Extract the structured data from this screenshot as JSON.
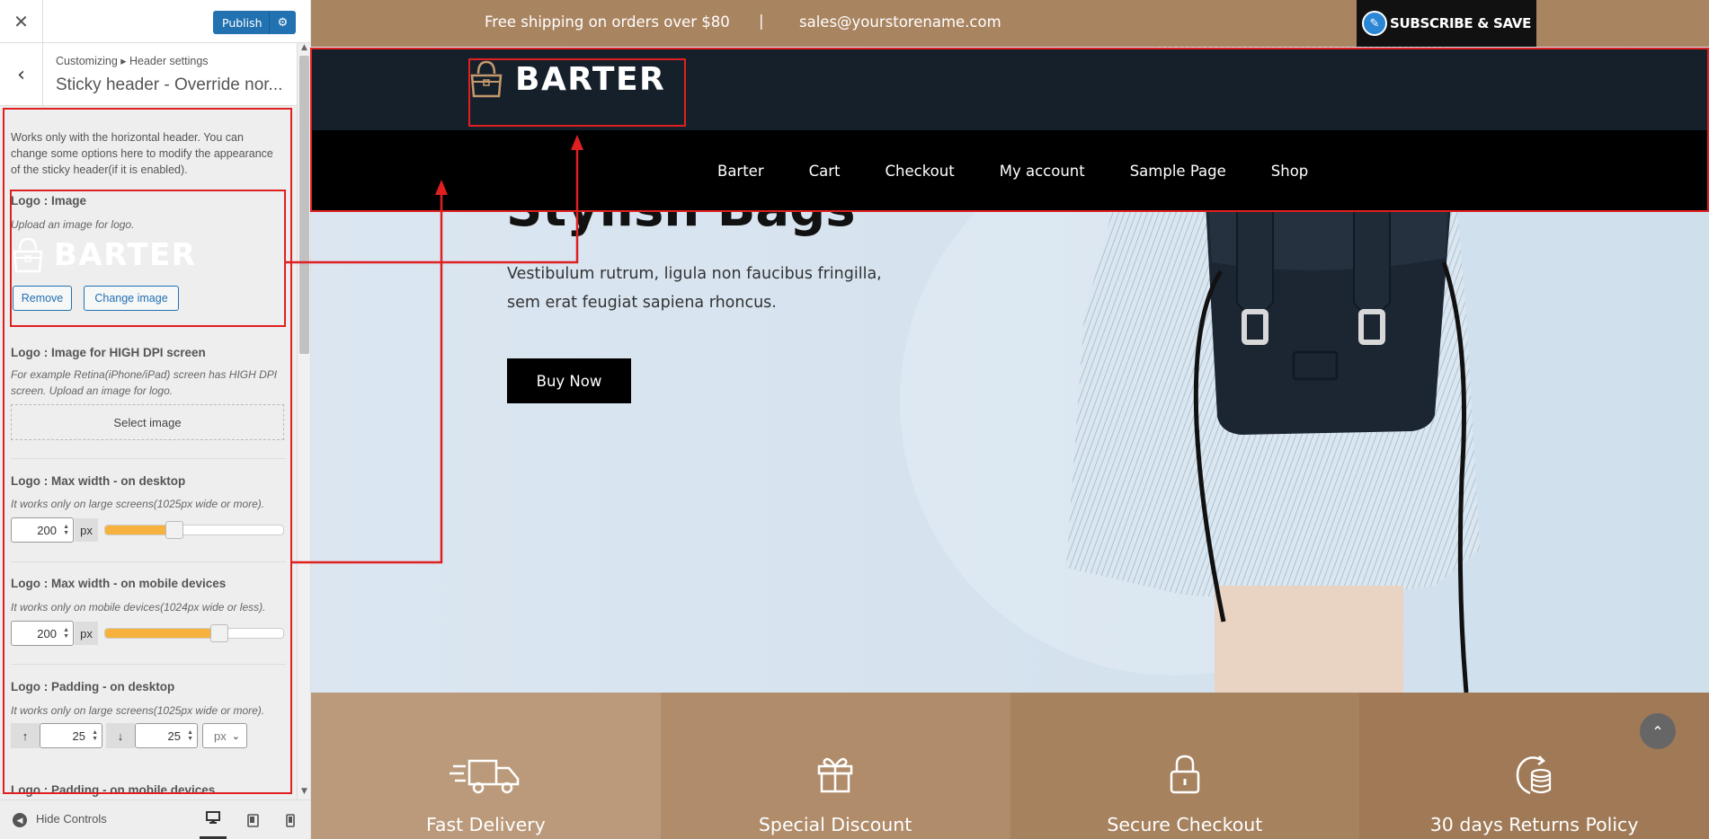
{
  "customizer": {
    "close_icon": "✕",
    "publish_label": "Publish",
    "publish_gear_icon": "⚙",
    "back_icon": "‹",
    "breadcrumb": "Customizing ▸ Header settings",
    "section_title": "Sticky header - Override nor...",
    "description": "Works only with the horizontal header. You can change some options here to modify the appearance of the sticky header(if it is enabled).",
    "logo_image": {
      "title": "Logo : Image",
      "note": "Upload an image for logo.",
      "preview_text": "BARTER",
      "remove_label": "Remove",
      "change_label": "Change image"
    },
    "logo_hidpi": {
      "title": "Logo : Image for HIGH DPI screen",
      "note": "For example Retina(iPhone/iPad) screen has HIGH DPI screen. Upload an image for logo.",
      "select_label": "Select image"
    },
    "max_width_desktop": {
      "title": "Logo : Max width - on desktop",
      "note": "It works only on large screens(1025px wide or more).",
      "value": "200",
      "unit": "px",
      "slider_fraction": 0.39
    },
    "max_width_mobile": {
      "title": "Logo : Max width - on mobile devices",
      "note": "It works only on mobile devices(1024px wide or less).",
      "value": "200",
      "unit": "px",
      "slider_fraction": 0.64
    },
    "padding_desktop": {
      "title": "Logo : Padding - on desktop",
      "note": "It works only on large screens(1025px wide or more).",
      "top_icon": "↑",
      "top_value": "25",
      "bottom_icon": "↓",
      "bottom_value": "25",
      "unit": "px"
    },
    "padding_mobile_title": "Logo : Padding - on mobile devices",
    "footer": {
      "hide_label": "Hide Controls"
    }
  },
  "site": {
    "topbar": {
      "promo": "Free shipping on orders over $80",
      "separator": "|",
      "email": "sales@yourstorename.com",
      "subscribe_label": "SUBSCRIBE & SAVE"
    },
    "logo_text": "BARTER",
    "nav": [
      "Barter",
      "Cart",
      "Checkout",
      "My account",
      "Sample Page",
      "Shop"
    ],
    "hero": {
      "heading": "Stylish Bags",
      "text": "Vestibulum rutrum, ligula non faucibus fringilla, sem erat feugiat sapiena rhoncus.",
      "button": "Buy Now"
    },
    "features": [
      {
        "label": "Fast Delivery",
        "icon": "truck-icon",
        "color": "#bb9a7b"
      },
      {
        "label": "Special Discount",
        "icon": "gift-icon",
        "color": "#b08c6b"
      },
      {
        "label": "Secure Checkout",
        "icon": "lock-icon",
        "color": "#a7825f"
      },
      {
        "label": "30 days Returns Policy",
        "icon": "coins-return-icon",
        "color": "#a07a57"
      }
    ],
    "scroll_top_icon": "⌃"
  },
  "colors": {
    "accent": "#2271b1",
    "brand_brown": "#a98461",
    "slider_fill": "#f6b23c",
    "annotation_red": "#e02020"
  }
}
